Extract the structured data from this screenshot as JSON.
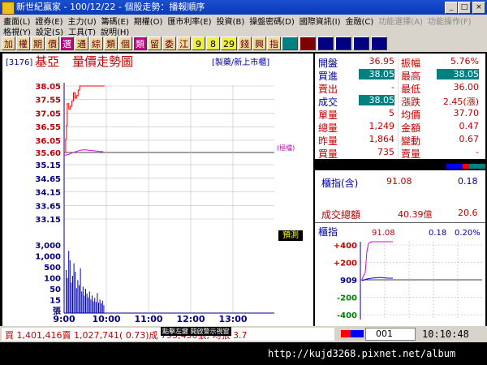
{
  "window": {
    "title": "新世紀贏家 - 100/12/22 - 個股走勢：播報順序",
    "btn_min": "_",
    "btn_max": "□",
    "btn_close": "×"
  },
  "menu": {
    "row1": [
      "畫面(L)",
      "證券(E)",
      "主力(U)",
      "籌碼(E)",
      "期權(O)",
      "匯市利率(E)",
      "投資(B)",
      "操盤密碼(D)",
      "國際資訊(I)",
      "金融(C)",
      "功能選擇(A)",
      "功能操作(F)"
    ],
    "row2": [
      "格視(Y)",
      "設定(S)",
      "工具(T)",
      "說明(H)"
    ]
  },
  "toolbar": {
    "buttons": [
      "加",
      "權",
      "期",
      "價",
      "選",
      "通",
      "綜",
      "類",
      "個",
      "類",
      "留",
      "委",
      "江",
      "9",
      "8",
      "29",
      "錢",
      "興",
      "指"
    ]
  },
  "stock": {
    "code": "[3176]",
    "name": "基亞",
    "chart_title": "量價走勢圖",
    "industry": "[製藥/新上市櫃]",
    "ref_label": "(極檔)",
    "estimate_btn": "預測"
  },
  "chart_data": {
    "type": "line",
    "title": "量價走勢圖",
    "price_ticks": [
      "38.05",
      "37.55",
      "37.05",
      "36.55",
      "36.05",
      "35.60",
      "35.15",
      "34.65",
      "34.15",
      "33.65",
      "33.15"
    ],
    "volume_ticks": [
      "3,000",
      "1,000",
      "500",
      "100",
      "50",
      "15",
      "張"
    ],
    "time_ticks": [
      "9:00",
      "10:00",
      "11:00",
      "12:00",
      "13:00"
    ],
    "ref_price": 35.6,
    "ylim": [
      33.15,
      38.05
    ],
    "price_series": {
      "x": [
        0,
        2,
        3,
        4,
        6,
        8,
        10,
        12,
        14,
        16,
        18,
        20,
        22,
        24,
        26,
        28,
        30,
        35,
        40,
        44,
        48,
        52
      ],
      "y": [
        35.6,
        36.1,
        36.6,
        37.4,
        37.2,
        37.3,
        37.5,
        37.8,
        37.6,
        37.7,
        37.9,
        38.05,
        38.05,
        38.05,
        38.05,
        38.05,
        38.05,
        38.05,
        38.05,
        38.05,
        38.05,
        38.05
      ]
    },
    "avg_series": {
      "x": [
        0,
        5,
        10,
        15,
        20,
        25,
        30,
        35,
        40,
        45,
        50
      ],
      "y": [
        35.5,
        35.52,
        35.58,
        35.63,
        35.68,
        35.7,
        35.69,
        35.67,
        35.66,
        35.64,
        35.63
      ]
    },
    "volume": [
      1200,
      800,
      2500,
      1800,
      600,
      900,
      1600,
      1100,
      400,
      700,
      500,
      1300,
      300,
      450,
      200,
      380,
      250,
      160,
      300,
      120,
      200,
      90,
      150,
      80,
      260,
      70,
      120,
      60,
      100,
      40
    ]
  },
  "quote": [
    {
      "l1": "開盤",
      "v1": "36.95",
      "l2": "振幅",
      "v2": "5.76%"
    },
    {
      "l1": "買進",
      "v1": "38.05",
      "l2": "最高",
      "v2": "38.05"
    },
    {
      "l1": "賣出",
      "v1": "-",
      "l2": "最低",
      "v2": "36.00"
    },
    {
      "l1": "成交",
      "v1": "38.05",
      "l2": "漲跌",
      "v2": "2.45(漲)"
    },
    {
      "l1": "單量",
      "v1": "5",
      "l2": "均價",
      "v2": "37.70"
    },
    {
      "l1": "總量",
      "v1": "1,249",
      "l2": "金額",
      "v2": "0.47"
    },
    {
      "l1": "昨量",
      "v1": "1,864",
      "l2": "變動",
      "v2": "0.67"
    },
    {
      "l1": "買量",
      "v1": "735",
      "l2": "賣量",
      "v2": "-"
    }
  ],
  "index_box": {
    "label": "櫃指(含)",
    "value": "91.08",
    "change": "0.18",
    "turnover_label": "成交總額",
    "turnover": "40.39億",
    "turnover_change": "20.6"
  },
  "mini_chart": {
    "label": "櫃指",
    "value": "91.08",
    "change": "0.18",
    "pct": "0.20%",
    "ticks": [
      "+400",
      "+200",
      "909",
      "-200",
      "-400"
    ]
  },
  "status": {
    "text": "買 1,401,416賣 1,027,741( 0.73)成 793,450張, 均張 3.7",
    "overlay": "點擊左鍵 開啟警示視窗",
    "counter": "001",
    "time": "10:10:48"
  },
  "footer": {
    "url": "http://kujd3268.pixnet.net/album"
  }
}
